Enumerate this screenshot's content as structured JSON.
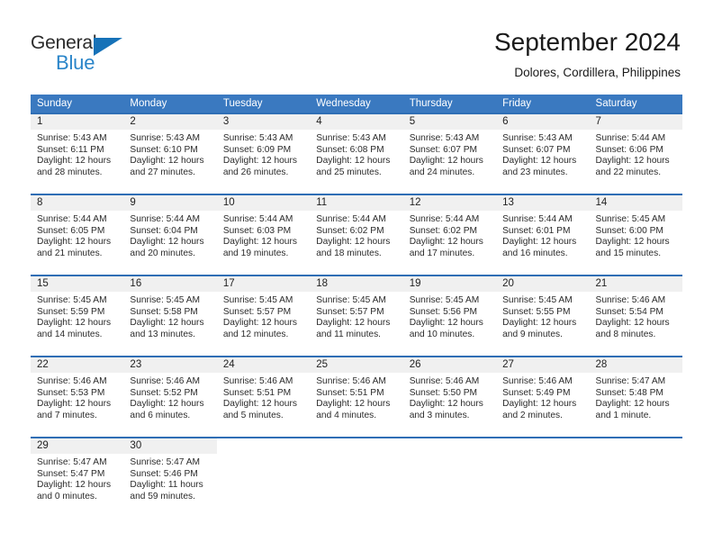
{
  "brand": {
    "name_dark": "General",
    "name_blue": "Blue",
    "triangle_color": "#1672b8",
    "blue_text_color": "#2a85c9"
  },
  "header": {
    "title": "September 2024",
    "subtitle": "Dolores, Cordillera, Philippines"
  },
  "theme": {
    "header_bg": "#3a79c0",
    "row_border": "#2f6eb5",
    "daynum_band": "#f0f0f0"
  },
  "weekdays": [
    "Sunday",
    "Monday",
    "Tuesday",
    "Wednesday",
    "Thursday",
    "Friday",
    "Saturday"
  ],
  "labels": {
    "sunrise_prefix": "Sunrise:",
    "sunset_prefix": "Sunset:",
    "daylight_prefix": "Daylight:"
  },
  "weeks": [
    [
      {
        "day": "1",
        "sunrise": "Sunrise: 5:43 AM",
        "sunset": "Sunset: 6:11 PM",
        "daylight1": "Daylight: 12 hours",
        "daylight2": "and 28 minutes."
      },
      {
        "day": "2",
        "sunrise": "Sunrise: 5:43 AM",
        "sunset": "Sunset: 6:10 PM",
        "daylight1": "Daylight: 12 hours",
        "daylight2": "and 27 minutes."
      },
      {
        "day": "3",
        "sunrise": "Sunrise: 5:43 AM",
        "sunset": "Sunset: 6:09 PM",
        "daylight1": "Daylight: 12 hours",
        "daylight2": "and 26 minutes."
      },
      {
        "day": "4",
        "sunrise": "Sunrise: 5:43 AM",
        "sunset": "Sunset: 6:08 PM",
        "daylight1": "Daylight: 12 hours",
        "daylight2": "and 25 minutes."
      },
      {
        "day": "5",
        "sunrise": "Sunrise: 5:43 AM",
        "sunset": "Sunset: 6:07 PM",
        "daylight1": "Daylight: 12 hours",
        "daylight2": "and 24 minutes."
      },
      {
        "day": "6",
        "sunrise": "Sunrise: 5:43 AM",
        "sunset": "Sunset: 6:07 PM",
        "daylight1": "Daylight: 12 hours",
        "daylight2": "and 23 minutes."
      },
      {
        "day": "7",
        "sunrise": "Sunrise: 5:44 AM",
        "sunset": "Sunset: 6:06 PM",
        "daylight1": "Daylight: 12 hours",
        "daylight2": "and 22 minutes."
      }
    ],
    [
      {
        "day": "8",
        "sunrise": "Sunrise: 5:44 AM",
        "sunset": "Sunset: 6:05 PM",
        "daylight1": "Daylight: 12 hours",
        "daylight2": "and 21 minutes."
      },
      {
        "day": "9",
        "sunrise": "Sunrise: 5:44 AM",
        "sunset": "Sunset: 6:04 PM",
        "daylight1": "Daylight: 12 hours",
        "daylight2": "and 20 minutes."
      },
      {
        "day": "10",
        "sunrise": "Sunrise: 5:44 AM",
        "sunset": "Sunset: 6:03 PM",
        "daylight1": "Daylight: 12 hours",
        "daylight2": "and 19 minutes."
      },
      {
        "day": "11",
        "sunrise": "Sunrise: 5:44 AM",
        "sunset": "Sunset: 6:02 PM",
        "daylight1": "Daylight: 12 hours",
        "daylight2": "and 18 minutes."
      },
      {
        "day": "12",
        "sunrise": "Sunrise: 5:44 AM",
        "sunset": "Sunset: 6:02 PM",
        "daylight1": "Daylight: 12 hours",
        "daylight2": "and 17 minutes."
      },
      {
        "day": "13",
        "sunrise": "Sunrise: 5:44 AM",
        "sunset": "Sunset: 6:01 PM",
        "daylight1": "Daylight: 12 hours",
        "daylight2": "and 16 minutes."
      },
      {
        "day": "14",
        "sunrise": "Sunrise: 5:45 AM",
        "sunset": "Sunset: 6:00 PM",
        "daylight1": "Daylight: 12 hours",
        "daylight2": "and 15 minutes."
      }
    ],
    [
      {
        "day": "15",
        "sunrise": "Sunrise: 5:45 AM",
        "sunset": "Sunset: 5:59 PM",
        "daylight1": "Daylight: 12 hours",
        "daylight2": "and 14 minutes."
      },
      {
        "day": "16",
        "sunrise": "Sunrise: 5:45 AM",
        "sunset": "Sunset: 5:58 PM",
        "daylight1": "Daylight: 12 hours",
        "daylight2": "and 13 minutes."
      },
      {
        "day": "17",
        "sunrise": "Sunrise: 5:45 AM",
        "sunset": "Sunset: 5:57 PM",
        "daylight1": "Daylight: 12 hours",
        "daylight2": "and 12 minutes."
      },
      {
        "day": "18",
        "sunrise": "Sunrise: 5:45 AM",
        "sunset": "Sunset: 5:57 PM",
        "daylight1": "Daylight: 12 hours",
        "daylight2": "and 11 minutes."
      },
      {
        "day": "19",
        "sunrise": "Sunrise: 5:45 AM",
        "sunset": "Sunset: 5:56 PM",
        "daylight1": "Daylight: 12 hours",
        "daylight2": "and 10 minutes."
      },
      {
        "day": "20",
        "sunrise": "Sunrise: 5:45 AM",
        "sunset": "Sunset: 5:55 PM",
        "daylight1": "Daylight: 12 hours",
        "daylight2": "and 9 minutes."
      },
      {
        "day": "21",
        "sunrise": "Sunrise: 5:46 AM",
        "sunset": "Sunset: 5:54 PM",
        "daylight1": "Daylight: 12 hours",
        "daylight2": "and 8 minutes."
      }
    ],
    [
      {
        "day": "22",
        "sunrise": "Sunrise: 5:46 AM",
        "sunset": "Sunset: 5:53 PM",
        "daylight1": "Daylight: 12 hours",
        "daylight2": "and 7 minutes."
      },
      {
        "day": "23",
        "sunrise": "Sunrise: 5:46 AM",
        "sunset": "Sunset: 5:52 PM",
        "daylight1": "Daylight: 12 hours",
        "daylight2": "and 6 minutes."
      },
      {
        "day": "24",
        "sunrise": "Sunrise: 5:46 AM",
        "sunset": "Sunset: 5:51 PM",
        "daylight1": "Daylight: 12 hours",
        "daylight2": "and 5 minutes."
      },
      {
        "day": "25",
        "sunrise": "Sunrise: 5:46 AM",
        "sunset": "Sunset: 5:51 PM",
        "daylight1": "Daylight: 12 hours",
        "daylight2": "and 4 minutes."
      },
      {
        "day": "26",
        "sunrise": "Sunrise: 5:46 AM",
        "sunset": "Sunset: 5:50 PM",
        "daylight1": "Daylight: 12 hours",
        "daylight2": "and 3 minutes."
      },
      {
        "day": "27",
        "sunrise": "Sunrise: 5:46 AM",
        "sunset": "Sunset: 5:49 PM",
        "daylight1": "Daylight: 12 hours",
        "daylight2": "and 2 minutes."
      },
      {
        "day": "28",
        "sunrise": "Sunrise: 5:47 AM",
        "sunset": "Sunset: 5:48 PM",
        "daylight1": "Daylight: 12 hours",
        "daylight2": "and 1 minute."
      }
    ],
    [
      {
        "day": "29",
        "sunrise": "Sunrise: 5:47 AM",
        "sunset": "Sunset: 5:47 PM",
        "daylight1": "Daylight: 12 hours",
        "daylight2": "and 0 minutes."
      },
      {
        "day": "30",
        "sunrise": "Sunrise: 5:47 AM",
        "sunset": "Sunset: 5:46 PM",
        "daylight1": "Daylight: 11 hours",
        "daylight2": "and 59 minutes."
      },
      {
        "day": "",
        "sunrise": "",
        "sunset": "",
        "daylight1": "",
        "daylight2": ""
      },
      {
        "day": "",
        "sunrise": "",
        "sunset": "",
        "daylight1": "",
        "daylight2": ""
      },
      {
        "day": "",
        "sunrise": "",
        "sunset": "",
        "daylight1": "",
        "daylight2": ""
      },
      {
        "day": "",
        "sunrise": "",
        "sunset": "",
        "daylight1": "",
        "daylight2": ""
      },
      {
        "day": "",
        "sunrise": "",
        "sunset": "",
        "daylight1": "",
        "daylight2": ""
      }
    ]
  ]
}
